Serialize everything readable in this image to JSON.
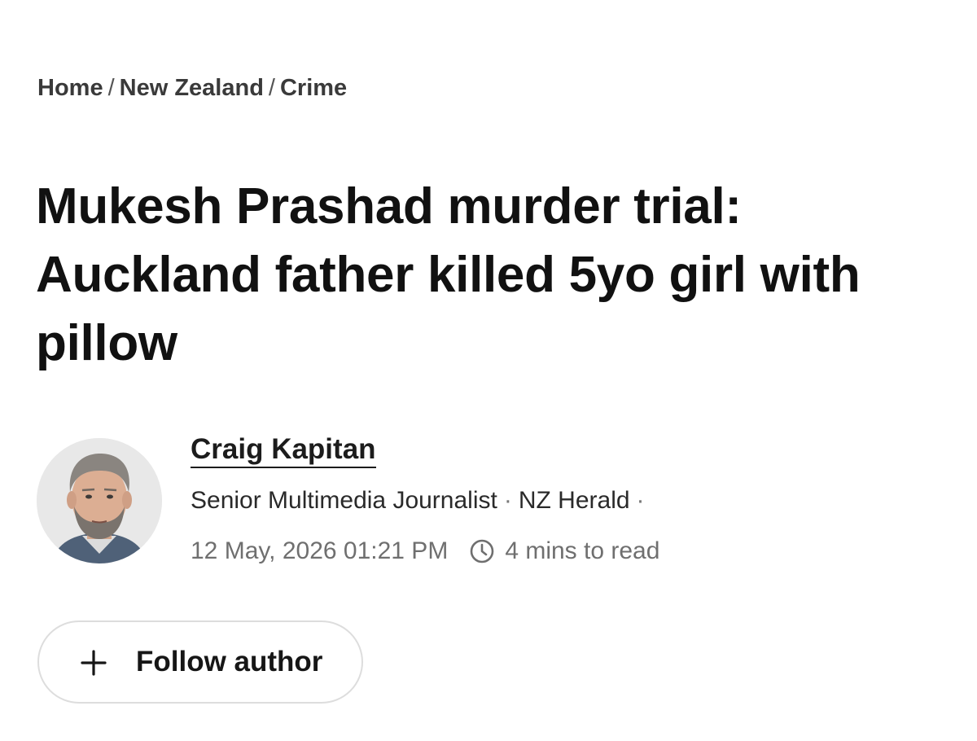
{
  "breadcrumb": {
    "items": [
      "Home",
      "New Zealand",
      "Crime"
    ],
    "separator": "/"
  },
  "article": {
    "headline": "Mukesh Prashad murder trial: Auckland father killed 5yo girl with pillow"
  },
  "author": {
    "name": "Craig Kapitan",
    "role": "Senior Multimedia Journalist",
    "outlet": "NZ Herald",
    "dot": "·",
    "avatar_icon": "author-photo"
  },
  "meta": {
    "published": "12 May, 2026 01:21 PM",
    "read_time": "4 mins to read",
    "clock_icon": "clock-icon"
  },
  "follow": {
    "label": "Follow author",
    "icon": "plus-icon"
  }
}
